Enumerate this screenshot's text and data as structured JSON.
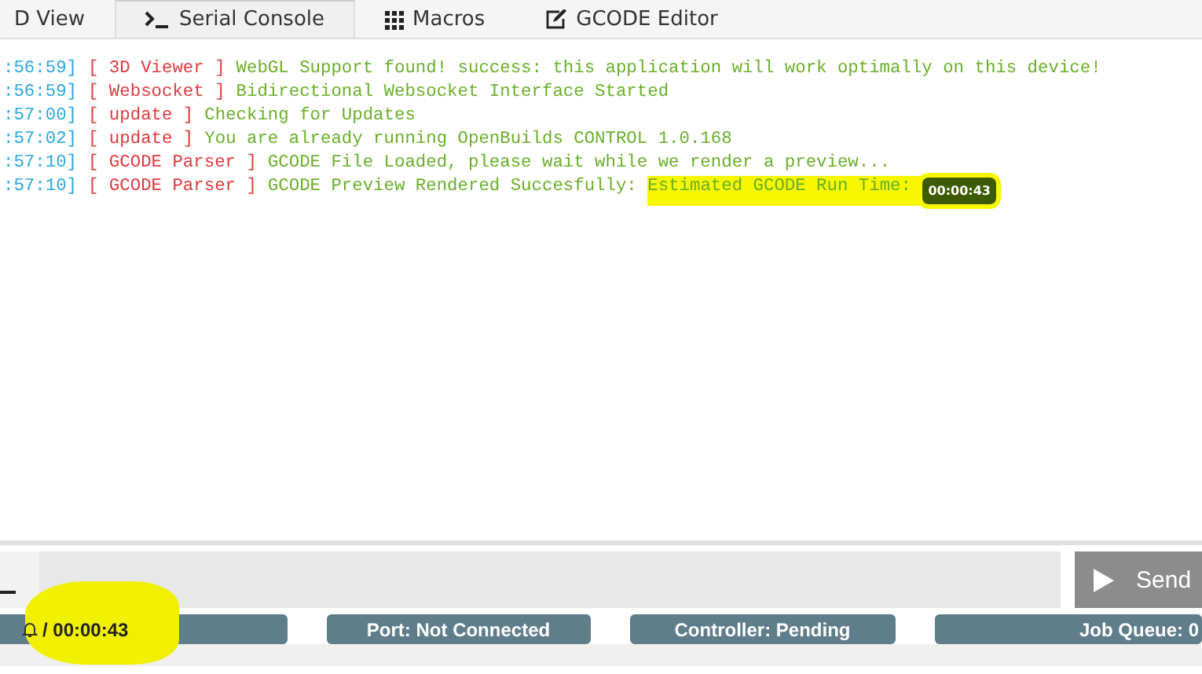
{
  "tabs": [
    {
      "label": "D View",
      "selected": false
    },
    {
      "label": "Serial Console",
      "selected": true
    },
    {
      "label": "Macros",
      "selected": false
    },
    {
      "label": "GCODE Editor",
      "selected": false
    }
  ],
  "log": [
    {
      "time": ":56:59]",
      "source": "[ 3D Viewer ]",
      "message": "WebGL Support found! success: this application will work optimally on this device!"
    },
    {
      "time": ":56:59]",
      "source": "[ Websocket ]",
      "message": "Bidirectional Websocket Interface Started"
    },
    {
      "time": ":57:00]",
      "source": "[ update ]",
      "message": "Checking for Updates"
    },
    {
      "time": ":57:02]",
      "source": "[ update ]",
      "message": "You are already running OpenBuilds CONTROL 1.0.168"
    },
    {
      "time": ":57:10]",
      "source": "[ GCODE Parser ]",
      "message": "GCODE File Loaded, please wait while we render a preview..."
    },
    {
      "time": ":57:10]",
      "source": "[ GCODE Parser ]",
      "message": "GCODE Preview Rendered Succesfully: ",
      "highlighted_text": "Estimated GCODE Run Time: ",
      "badge": "00:00:43"
    }
  ],
  "send_button": {
    "label": "Send"
  },
  "status_bar": [
    {
      "kind": "timer",
      "text": "/ 00:00:43",
      "highlighted": true
    },
    {
      "kind": "plain",
      "text": "Port: Not Connected",
      "highlighted": false
    },
    {
      "kind": "plain",
      "text": "Controller: Pending",
      "highlighted": false
    },
    {
      "kind": "plain",
      "text": "Job Queue: 0",
      "highlighted": false
    }
  ]
}
